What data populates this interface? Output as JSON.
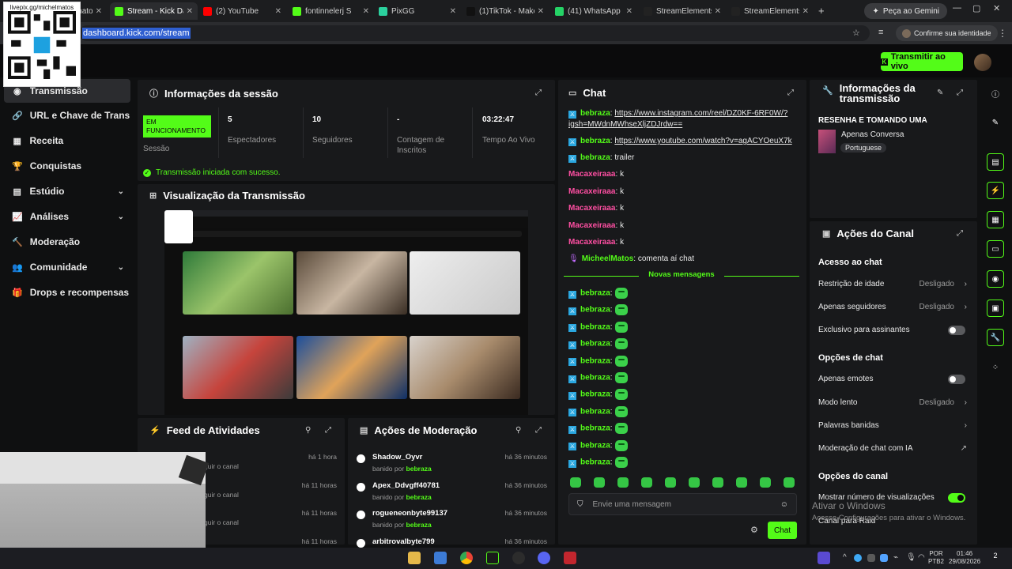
{
  "browser": {
    "tabs": [
      {
        "label": "livepix.gg/michelmatos",
        "active": false
      },
      {
        "label": "Stream - Kick Dash",
        "active": true
      },
      {
        "label": "(2) YouTube",
        "active": false
      },
      {
        "label": "fontinnelerj S",
        "active": false
      },
      {
        "label": "PixGG",
        "active": false
      },
      {
        "label": "(1)TikTok - Make",
        "active": false
      },
      {
        "label": "(41) WhatsApp",
        "active": false
      },
      {
        "label": "StreamElements",
        "active": false
      },
      {
        "label": "StreamElements",
        "active": false
      }
    ],
    "gemini_label": "Peça ao Gemini",
    "url": "dashboard.kick.com/stream",
    "identity_label": "Confirme sua identidade"
  },
  "overlay": {
    "qr_caption": "livepix.gg/michelmatos"
  },
  "header": {
    "go_live_label": "Transmitir ao vivo"
  },
  "sidebar": {
    "items": [
      {
        "label": "Transmissão",
        "icon": "broadcast-icon",
        "active": true
      },
      {
        "label": "URL e Chave de Transmissão",
        "icon": "link-icon"
      },
      {
        "label": "Receita",
        "icon": "revenue-icon"
      },
      {
        "label": "Conquistas",
        "icon": "trophy-icon"
      },
      {
        "label": "Estúdio",
        "icon": "studio-icon",
        "expandable": true
      },
      {
        "label": "Análises",
        "icon": "analytics-icon",
        "expandable": true
      },
      {
        "label": "Moderação",
        "icon": "hammer-icon"
      },
      {
        "label": "Comunidade",
        "icon": "community-icon",
        "expandable": true
      },
      {
        "label": "Drops e recompensas",
        "icon": "gift-icon"
      }
    ]
  },
  "session": {
    "title": "Informações da sessão",
    "status_badge": "EM FUNCIONAMENTO",
    "status_label": "Sessão",
    "stats": [
      {
        "value": "5",
        "label": "Espectadores"
      },
      {
        "value": "10",
        "label": "Seguidores"
      },
      {
        "value": "-",
        "label": "Contagem de Inscritos"
      },
      {
        "value": "03:22:47",
        "label": "Tempo Ao Vivo"
      }
    ],
    "success_message": "Transmissão iniciada com sucesso."
  },
  "preview": {
    "title": "Visualização da Transmissão"
  },
  "chat": {
    "title": "Chat",
    "messages": [
      {
        "user": "bebraza",
        "text": "https://www.instagram.com/reel/DZ0KF-6RF0W/?",
        "cont": "igsh=MWdnMWhseXljZDJrdw==",
        "color": "#53fc18",
        "badge": true,
        "link": true
      },
      {
        "user": "bebraza",
        "text": "https://www.youtube.com/watch?v=agACYOeuX7k",
        "color": "#53fc18",
        "badge": true,
        "link": true
      },
      {
        "user": "bebraza",
        "text": "trailer",
        "color": "#53fc18",
        "badge": true
      },
      {
        "user": "Macaxeiraaa",
        "text": "k",
        "color": "#ff4fa3"
      },
      {
        "user": "Macaxeiraaa",
        "text": "k",
        "color": "#ff4fa3"
      },
      {
        "user": "Macaxeiraaa",
        "text": "k",
        "color": "#ff4fa3"
      },
      {
        "user": "Macaxeiraaa",
        "text": "k",
        "color": "#ff4fa3"
      },
      {
        "user": "Macaxeiraaa",
        "text": "k",
        "color": "#ff4fa3"
      },
      {
        "user": "MicheelMatos",
        "text": "comenta aí chat",
        "color": "#53fc18",
        "mic": true
      }
    ],
    "new_messages_label": "Novas mensagens",
    "emote_user": "bebraza",
    "emote_count": 11,
    "input_placeholder": "Envie uma mensagem",
    "send_label": "Chat"
  },
  "stream_info": {
    "title": "Informações da transmissão",
    "stream_title": "RESENHA E TOMANDO UMA",
    "category": "Apenas Conversa",
    "language": "Portuguese"
  },
  "channel_actions": {
    "title": "Ações do Canal",
    "chat_access_heading": "Acesso ao chat",
    "age_restriction": {
      "label": "Restrição de idade",
      "value": "Desligado"
    },
    "followers_only": {
      "label": "Apenas seguidores",
      "value": "Desligado"
    },
    "subscribers_only": {
      "label": "Exclusivo para assinantes",
      "on": false
    },
    "chat_options_heading": "Opções de chat",
    "emotes_only": {
      "label": "Apenas emotes",
      "on": false
    },
    "slow_mode": {
      "label": "Modo lento",
      "value": "Desligado"
    },
    "banned_words": {
      "label": "Palavras banidas"
    },
    "ai_moderation": {
      "label": "Moderação de chat com IA"
    },
    "channel_options_heading": "Opções do canal",
    "show_views": {
      "label": "Mostrar número de visualizações",
      "on": true
    },
    "raid_channel": {
      "label": "Canal para Raid"
    }
  },
  "activity_feed": {
    "title": "Feed de Atividades",
    "items": [
      {
        "sub": "guir o canal",
        "time": "há 1 hora"
      },
      {
        "sub": "guir o canal",
        "time": "há 11 horas"
      },
      {
        "sub": "guir o canal",
        "time": "há 11 horas"
      },
      {
        "sub": "",
        "time": "há 11 horas"
      }
    ]
  },
  "moderation": {
    "title": "Ações de Moderação",
    "items": [
      {
        "user": "Shadow_Oyvr",
        "prefix": "banido por",
        "by": "bebraza",
        "time": "há 36 minutos"
      },
      {
        "user": "Apex_Ddvgff40781",
        "prefix": "banido por",
        "by": "bebraza",
        "time": "há 36 minutos"
      },
      {
        "user": "rogueneonbyte99137",
        "prefix": "banido por",
        "by": "bebraza",
        "time": "há 36 minutos"
      },
      {
        "user": "arbitrovalbyte799",
        "prefix": "",
        "by": "",
        "time": "há 36 minutos"
      }
    ]
  },
  "windows_watermark": {
    "title": "Ativar o Windows",
    "subtitle": "Acesse Configurações para ativar o Windows."
  },
  "taskbar": {
    "language": "POR",
    "layout": "PTB2",
    "time": "01:46",
    "date": "29/08/2026",
    "notification_count": "2"
  }
}
